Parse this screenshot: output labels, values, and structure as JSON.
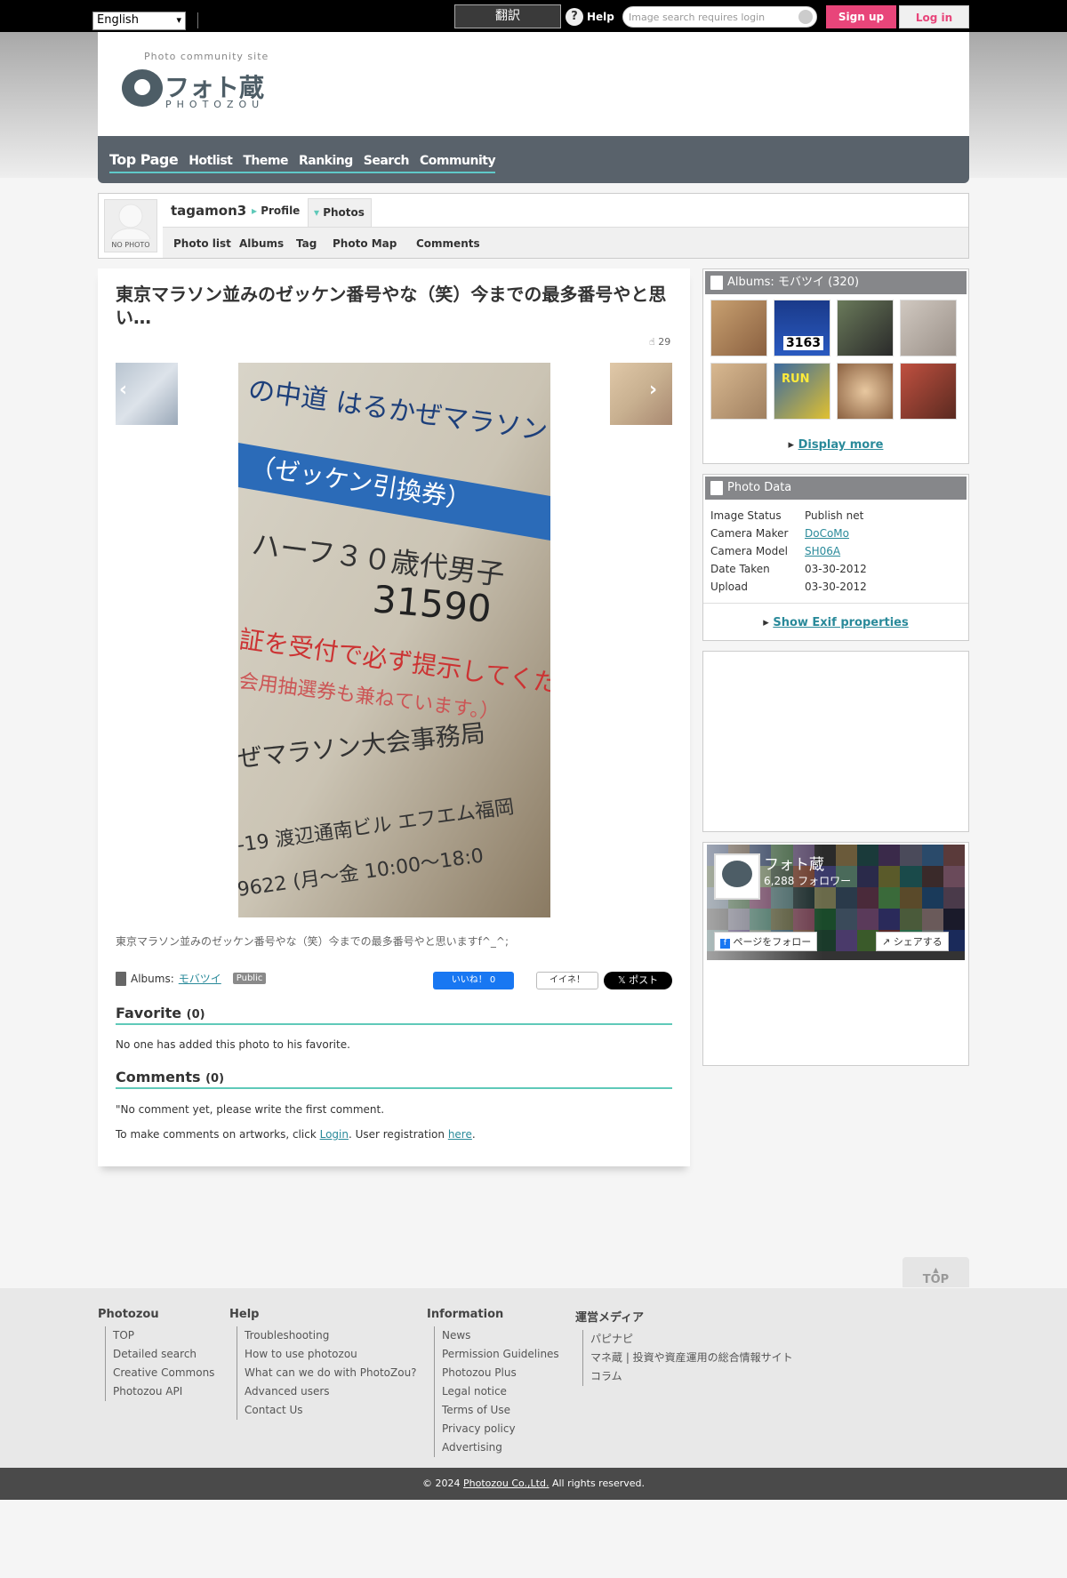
{
  "topbar": {
    "language": "English",
    "translate": "翻訳",
    "help": "Help",
    "search_placeholder": "Image search requires login",
    "signup": "Sign up",
    "login": "Log in"
  },
  "header": {
    "tagline": "Photo community site",
    "logo_jp": "フォト蔵",
    "logo_en": "PHOTOZOU",
    "nav": [
      "Top Page",
      "Hotlist",
      "Theme",
      "Ranking",
      "Search",
      "Community"
    ]
  },
  "profile": {
    "no_photo": "NO PHOTO",
    "username": "tagamon3",
    "tab_profile": "Profile",
    "tab_photos": "Photos",
    "subnav": [
      "Photo list",
      "Albums",
      "Tag",
      "Photo Map",
      "Comments"
    ]
  },
  "photo": {
    "title": "東京マラソン並みのゼッケン番号やな（笑）今までの最多番号やと思い…",
    "view_count": "29",
    "caption": "東京マラソン並みのゼッケン番号やな（笑）今までの最多番号やと思いますf^_^;",
    "album_label": "Albums:",
    "album_name": "モバツイ",
    "visibility": "Public",
    "fb_like": "いいね！ 0",
    "iine": "イイネ！",
    "x_post": "ポスト",
    "sign_lines": [
      "の中道 はるかぜマラソン",
      "（ゼッケン引換券）",
      "ハーフ３０歳代男子",
      "31590",
      "証を受付で必ず提示してくだ",
      "会用抽選券も兼ねています。）",
      "ぜマラソン大会事務局",
      "-19 渡辺通南ビル エフエム福岡",
      "9622 (月〜金 10:00〜18:0"
    ]
  },
  "favorite": {
    "title": "Favorite",
    "count": "(0)",
    "text": "No one has added this photo to his favorite."
  },
  "comments": {
    "title": "Comments",
    "count": "(0)",
    "empty": "\"No comment yet, please write the first comment.",
    "prompt_before": "To make comments on artworks, click ",
    "login_link": "Login",
    "prompt_middle": ". User registration ",
    "here_link": "here",
    "prompt_after": "."
  },
  "sidebar": {
    "albums_title": "Albums: モバツイ (320)",
    "display_more": "Display more",
    "photo_data_title": "Photo Data",
    "photo_data": [
      {
        "key": "Image Status",
        "value": "Publish net",
        "link": false
      },
      {
        "key": "Camera Maker",
        "value": "DoCoMo",
        "link": true
      },
      {
        "key": "Camera Model",
        "value": "SH06A",
        "link": true
      },
      {
        "key": "Date Taken",
        "value": "03-30-2012",
        "link": false
      },
      {
        "key": "Upload",
        "value": "03-30-2012",
        "link": false
      }
    ],
    "show_exif": "Show Exif properties",
    "fb_page_name": "フォト蔵",
    "fb_followers": "6,288 フォロワー",
    "fb_follow": "ページをフォロー",
    "fb_share": "シェアする",
    "thumb_3163": "3163",
    "thumb_run": "RUN"
  },
  "footer": {
    "totop": "TOP",
    "columns": [
      {
        "heading": "Photozou",
        "items": [
          "TOP",
          "Detailed search",
          "Creative Commons",
          "Photozou API"
        ]
      },
      {
        "heading": "Help",
        "items": [
          "Troubleshooting",
          "How to use photozou",
          "What can we do with PhotoZou?",
          "Advanced users",
          "Contact Us"
        ]
      },
      {
        "heading": "Information",
        "items": [
          "News",
          "Permission Guidelines",
          "Photozou Plus",
          "Legal notice",
          "Terms of Use",
          "Privacy policy",
          "Advertising"
        ]
      },
      {
        "heading": "運営メディア",
        "items": [
          "パピナピ",
          "マネ蔵 | 投資や資産運用の総合情報サイト",
          "コラム"
        ]
      }
    ],
    "copyright_prefix": "© 2024 ",
    "company": "Photozou Co.,Ltd.",
    "copyright_suffix": " All rights reserved."
  },
  "colors": {
    "accent": "#5fc9b9",
    "signup": "#e8457a",
    "nav_bg": "#59626b",
    "link": "#2a8a9a"
  }
}
